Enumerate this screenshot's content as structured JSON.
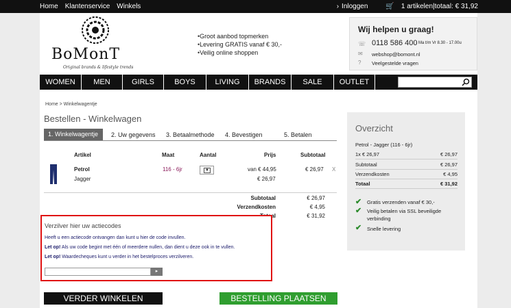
{
  "topbar": {
    "nav": [
      "Home",
      "Klantenservice",
      "Winkels"
    ],
    "login": "Inloggen",
    "cart": "1 artikelen|totaal: € 31,92"
  },
  "logo": {
    "name": "BoMonT",
    "tagline": "Original brands & lifestyle trends"
  },
  "usps": [
    "Groot aanbod topmerken",
    "Levering GRATIS vanaf € 30,-",
    "Veilig online shoppen"
  ],
  "help": {
    "title": "Wij helpen u graag!",
    "phone": "0118 586 400",
    "hours": "Ma t/m Vr 8.30 - 17.00u",
    "email": "webshop@bomont.nl",
    "faq": "Veelgestelde vragen"
  },
  "menu": [
    "WOMEN",
    "MEN",
    "GIRLS",
    "BOYS",
    "LIVING",
    "BRANDS",
    "SALE",
    "OUTLET"
  ],
  "breadcrumb": "Home > Winkelwagentje",
  "heading": "Bestellen - Winkelwagen",
  "steps": [
    "1. Winkelwagentje",
    "2. Uw gegevens",
    "3. Betaalmethode",
    "4. Bevestigen",
    "5. Betalen"
  ],
  "table": {
    "headers": [
      "Artikel",
      "Maat",
      "Aantal",
      "Prijs",
      "Subtotaal"
    ],
    "item": {
      "name": "Petrol",
      "brand": "Jagger",
      "size": "116 - 6jr",
      "old_price": "van € 44,95",
      "price": "€ 26,97",
      "subtotal": "€ 26,97",
      "remove": "X"
    }
  },
  "totals": [
    {
      "label": "Subtotaal",
      "value": "€ 26,97"
    },
    {
      "label": "Verzendkosten",
      "value": "€ 4,95"
    },
    {
      "label": "Totaal",
      "value": "€ 31,92"
    }
  ],
  "promo": {
    "title": "Verzilver hier uw actiecodes",
    "line1": "Heeft u een actiecode ontvangen dan kunt u hier de code invullen.",
    "line2_bold": "Let op!",
    "line2": " Als uw code begint met één of meerdere nullen, dan dient u deze ook in te vullen.",
    "line3_bold": "Let op!",
    "line3": " Waardecheques kunt u verder in het bestelproces verzilveren."
  },
  "buttons": {
    "continue": "VERDER WINKELEN",
    "order": "BESTELLING PLAATSEN"
  },
  "overview": {
    "title": "Overzicht",
    "item": "Petrol - Jagger (116 - 6jr)",
    "qty": "1x € 26,97",
    "qty_val": "€ 26,97",
    "rows": [
      {
        "label": "Subtotaal",
        "value": "€ 26,97"
      },
      {
        "label": "Verzendkosten",
        "value": "€ 4,95"
      },
      {
        "label": "Totaal",
        "value": "€ 31,92"
      }
    ],
    "checks": [
      "Gratis verzenden vanaf € 30,-",
      "Veilig betalen via SSL beveiligde verbinding",
      "Snelle levering"
    ]
  }
}
